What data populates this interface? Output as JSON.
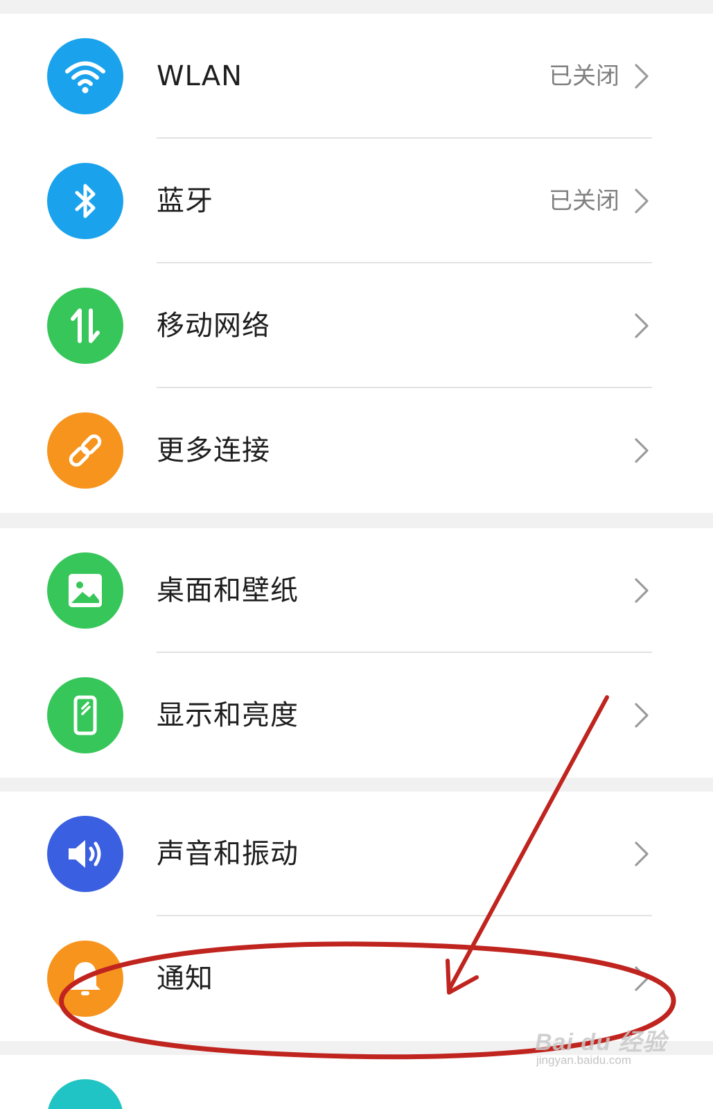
{
  "colors": {
    "blue": "#1aa3ec",
    "green": "#37c65a",
    "orange": "#f7941d",
    "indigo": "#3a5fe0",
    "teal": "#20c4c4",
    "annotation_red": "#c0241f"
  },
  "groups": [
    {
      "items": [
        {
          "label": "WLAN",
          "status": "已关闭",
          "icon": "wifi-icon",
          "color": "#1aa3ec"
        },
        {
          "label": "蓝牙",
          "status": "已关闭",
          "icon": "bluetooth-icon",
          "color": "#1aa3ec"
        },
        {
          "label": "移动网络",
          "status": "",
          "icon": "mobile-data-icon",
          "color": "#37c65a"
        },
        {
          "label": "更多连接",
          "status": "",
          "icon": "link-icon",
          "color": "#f7941d"
        }
      ]
    },
    {
      "items": [
        {
          "label": "桌面和壁纸",
          "status": "",
          "icon": "wallpaper-icon",
          "color": "#37c65a"
        },
        {
          "label": "显示和亮度",
          "status": "",
          "icon": "display-icon",
          "color": "#37c65a"
        }
      ]
    },
    {
      "items": [
        {
          "label": "声音和振动",
          "status": "",
          "icon": "sound-icon",
          "color": "#3a5fe0"
        },
        {
          "label": "通知",
          "status": "",
          "icon": "bell-icon",
          "color": "#f7941d"
        }
      ]
    }
  ],
  "watermark": {
    "brand": "Bai du 经验",
    "url": "jingyan.baidu.com"
  }
}
